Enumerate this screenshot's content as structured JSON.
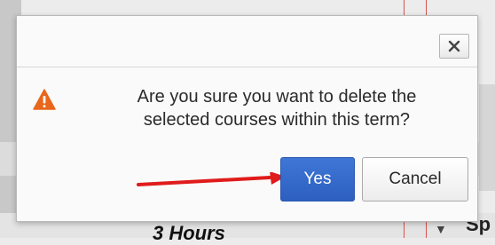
{
  "dialog": {
    "message": "Are you sure you want to delete the\nselected courses within this term?",
    "close_label": "×",
    "yes_label": "Yes",
    "cancel_label": "Cancel",
    "icon": "warning-icon"
  },
  "background": {
    "hours_text": "3 Hours",
    "sp_text": "Sp",
    "caret": "▼"
  },
  "colors": {
    "primary_button": "#3169d0",
    "warning": "#e8671c",
    "arrow": "#e01b1b",
    "table_rule": "#d9534f"
  }
}
